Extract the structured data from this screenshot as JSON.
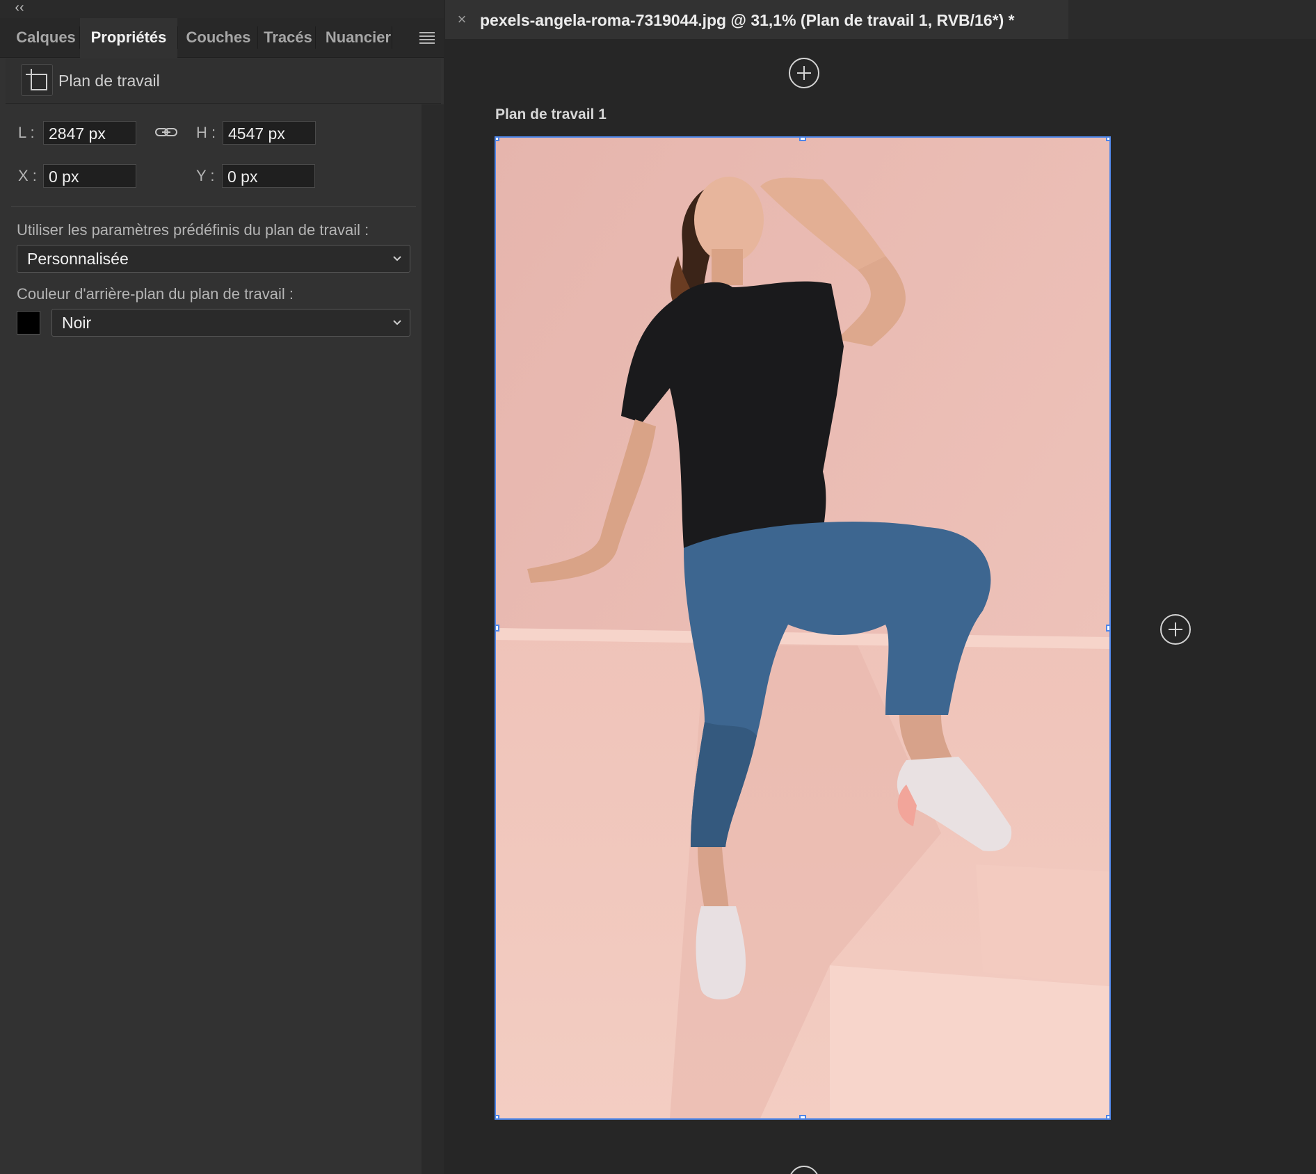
{
  "panel": {
    "collapse_glyph": "‹‹",
    "tabs": [
      {
        "label": "Calques",
        "active": false
      },
      {
        "label": "Propriétés",
        "active": true
      },
      {
        "label": "Couches",
        "active": false
      },
      {
        "label": "Tracés",
        "active": false
      },
      {
        "label": "Nuancier",
        "active": false
      }
    ],
    "menu_icon": "hamburger-menu-icon",
    "section": {
      "icon": "artboard-icon",
      "title": "Plan de travail"
    },
    "transform": {
      "width_label": "L :",
      "width_value": "2847 px",
      "height_label": "H :",
      "height_value": "4547 px",
      "link_icon": "link-icon",
      "x_label": "X :",
      "x_value": "0 px",
      "y_label": "Y :",
      "y_value": "0 px"
    },
    "preset": {
      "caption": "Utiliser les paramètres prédéfinis du plan de travail :",
      "selected": "Personnalisée"
    },
    "background": {
      "caption": "Couleur d'arrière-plan du plan de travail :",
      "selected": "Noir",
      "swatch_color": "#000000"
    }
  },
  "document": {
    "close_glyph": "×",
    "tab_title": "pexels-angela-roma-7319044.jpg @ 31,1% (Plan de travail 1, RVB/16*) *",
    "artboard_label": "Plan de travail 1",
    "selection_color": "#4f86e8",
    "photo_background": "#e8b9b1"
  }
}
